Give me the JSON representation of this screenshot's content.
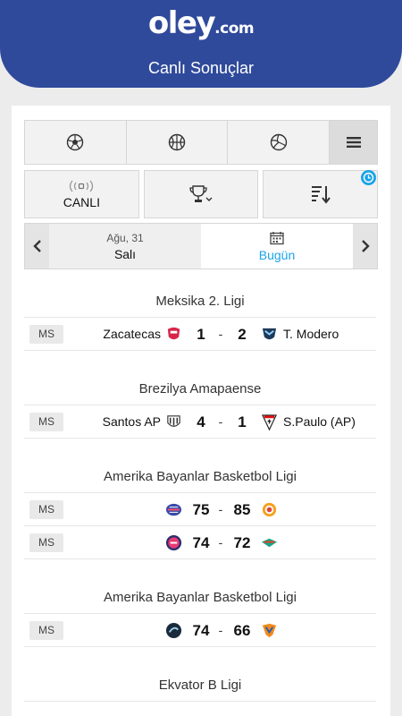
{
  "header": {
    "logo_main": "oley",
    "logo_domain": ".com",
    "subtitle": "Canlı Sonuçlar",
    "color": "#2f4a9b"
  },
  "sports_bar": {
    "tabs": [
      {
        "icon": "soccer-ball-icon"
      },
      {
        "icon": "basketball-icon"
      },
      {
        "icon": "volleyball-icon"
      },
      {
        "icon": "hamburger-menu-icon"
      }
    ]
  },
  "toolbar": {
    "live_label": "CANLI",
    "live_icon": "live-broadcast-icon",
    "trophy_icon": "trophy-dropdown-icon",
    "sort_icon": "sort-icon",
    "badge_icon": "clock-icon",
    "badge_color": "#1aa3e8"
  },
  "date_nav": {
    "prev_date": "Ağu, 31",
    "prev_day": "Salı",
    "today_label": "Bugün",
    "today_icon": "calendar-icon",
    "accent": "#1aa3e8"
  },
  "leagues": [
    {
      "name": "Meksika 2. Ligi",
      "matches": [
        {
          "status": "MS",
          "home": "Zacatecas",
          "home_score": "1",
          "away_score": "2",
          "away": "T. Modero"
        }
      ]
    },
    {
      "name": "Brezilya Amapaense",
      "matches": [
        {
          "status": "MS",
          "home": "Santos AP",
          "home_score": "4",
          "away_score": "1",
          "away": "S.Paulo (AP)"
        }
      ]
    },
    {
      "name": "Amerika Bayanlar Basketbol Ligi",
      "matches": [
        {
          "status": "MS",
          "home": "",
          "home_score": "75",
          "away_score": "85",
          "away": ""
        },
        {
          "status": "MS",
          "home": "",
          "home_score": "74",
          "away_score": "72",
          "away": ""
        }
      ]
    },
    {
      "name": "Amerika Bayanlar Basketbol Ligi",
      "matches": [
        {
          "status": "MS",
          "home": "",
          "home_score": "74",
          "away_score": "66",
          "away": ""
        }
      ]
    },
    {
      "name": "Ekvator B Ligi",
      "matches": []
    }
  ],
  "score_separator": "-"
}
